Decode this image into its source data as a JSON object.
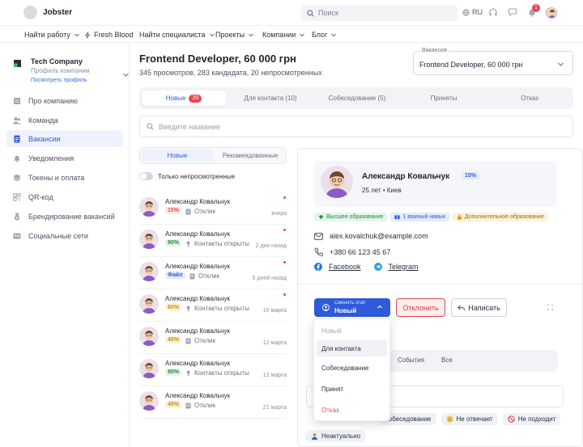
{
  "app": {
    "name": "Jobster"
  },
  "topbar": {
    "search_placeholder": "Поиск",
    "lang": "RU",
    "notif_count": "1"
  },
  "nav": [
    {
      "label": "Найти работу"
    },
    {
      "label": "Fresh Blood"
    },
    {
      "label": "Найти специалиста"
    },
    {
      "label": "Проекты"
    },
    {
      "label": "Компании"
    },
    {
      "label": "Блог"
    }
  ],
  "company": {
    "name": "Tech Company",
    "subtitle": "Профиль компании",
    "link": "Посмотреть профиль"
  },
  "sidebar": [
    {
      "label": "Про компанию",
      "icon": "building-icon"
    },
    {
      "label": "Команда",
      "icon": "team-icon"
    },
    {
      "label": "Вакансии",
      "icon": "document-icon",
      "active": true
    },
    {
      "label": "Уведомления",
      "icon": "bell-icon"
    },
    {
      "label": "Токены и оплата",
      "icon": "coin-icon"
    },
    {
      "label": "QR-код",
      "icon": "qr-icon"
    },
    {
      "label": "Брендирование вакансий",
      "icon": "medal-icon"
    },
    {
      "label": "Социальные сети",
      "icon": "id-card-icon"
    }
  ],
  "vacancy": {
    "title": "Frontend Developer, 60 000 грн",
    "stats": "345 просмотров, 283 кандидата, 20 непросмотренных",
    "select_label": "Вакансия",
    "select_value": "Frontend Developer, 60 000 грн"
  },
  "tabs": [
    {
      "label": "Новые",
      "badge": "20",
      "active": true
    },
    {
      "label": "Для контакта (10)"
    },
    {
      "label": "Собеседование (5)"
    },
    {
      "label": "Приняты"
    },
    {
      "label": "Отказ"
    }
  ],
  "search": {
    "placeholder": "Введите название"
  },
  "subtabs": [
    {
      "label": "Новые",
      "active": true
    },
    {
      "label": "Рекомендованные"
    }
  ],
  "toggle_label": "Только непросмотренные",
  "candidates": [
    {
      "name": "Александр Ковальчук",
      "pct": "15%",
      "pct_color": "#e5484d",
      "pct_bg": "#fde7e7",
      "status": "Отклик",
      "date": "вчера"
    },
    {
      "name": "Александр Ковальчук",
      "pct": "90%",
      "pct_color": "#1e8a45",
      "pct_bg": "#e3f6e9",
      "status": "Контакты открыты",
      "date": "2 дня назад"
    },
    {
      "name": "Александр Ковальчук",
      "pct": "Файл",
      "pct_color": "#2f5bd8",
      "pct_bg": "#e4ebfd",
      "status": "Отклик",
      "date": "5 дней назад"
    },
    {
      "name": "Александр Ковальчук",
      "pct": "60%",
      "pct_color": "#c98a06",
      "pct_bg": "#fdf3d9",
      "status": "Контакты открыты",
      "date": "10 марта"
    },
    {
      "name": "Александр Ковальчук",
      "pct": "40%",
      "pct_color": "#c98a06",
      "pct_bg": "#fdf3d9",
      "status": "Отклик",
      "date": "12 марта"
    },
    {
      "name": "Александр Ковальчук",
      "pct": "90%",
      "pct_color": "#1e8a45",
      "pct_bg": "#e3f6e9",
      "status": "Контакты открыты",
      "date": "12 марта"
    },
    {
      "name": "Александр Ковальчук",
      "pct": "40%",
      "pct_color": "#c98a06",
      "pct_bg": "#fdf3d9",
      "status": "Отклик",
      "date": "21 марта"
    }
  ],
  "profile": {
    "name": "Александр Ковальчук",
    "pct": "15%",
    "age": "25 лет",
    "city": "Киев",
    "tags": [
      {
        "label": "Высшее образование",
        "kind": "green"
      },
      {
        "label": "1 важный навык",
        "kind": "blue"
      },
      {
        "label": "Дополнительное образование",
        "kind": "yellow"
      }
    ],
    "email": "alex.kovalchuk@example.com",
    "phone": "+380 66 123 45 67",
    "facebook": "Facebook",
    "telegram": "Telegram"
  },
  "actions": {
    "stage_small": "Сменить этап",
    "stage_value": "Новый",
    "reject": "Отклонить",
    "write": "Написать"
  },
  "dropdown": [
    {
      "label": "Новый",
      "state": "disabled"
    },
    {
      "label": "Для контакта",
      "state": "hover"
    },
    {
      "label": "Собеседование",
      "state": ""
    },
    {
      "label": "Принят",
      "state": ""
    },
    {
      "label": "Отказ",
      "state": "danger"
    }
  ],
  "lower_tabs": [
    {
      "label": "События"
    },
    {
      "label": "Все"
    }
  ],
  "chips": [
    {
      "label": "Собеседование",
      "icon": "calendar-icon"
    },
    {
      "label": "Не отвечает",
      "icon": "emoji-icon"
    },
    {
      "label": "Не подходит",
      "icon": "no-icon"
    },
    {
      "label": "Неактуально",
      "icon": "person-icon"
    }
  ],
  "colors": {
    "accent": "#2f5bd8",
    "danger": "#e5484d",
    "text": "#1f2230"
  }
}
